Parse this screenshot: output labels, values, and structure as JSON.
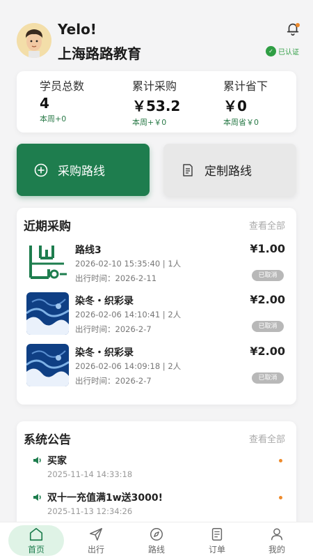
{
  "header": {
    "greeting": "Yelo!",
    "org_name": "上海路路教育",
    "verified_label": "已认证"
  },
  "stats": [
    {
      "label": "学员总数",
      "value": "4",
      "sub": "本周+0"
    },
    {
      "label": "累计采购",
      "value": "￥53.2",
      "sub": "本周+￥0"
    },
    {
      "label": "累计省下",
      "value": "￥0",
      "sub": "本周省￥0"
    }
  ],
  "actions": {
    "purchase_label": "采购路线",
    "custom_label": "定制路线"
  },
  "recent": {
    "title": "近期采购",
    "view_all": "查看全部",
    "items": [
      {
        "name": "路线3",
        "meta": "2026-02-10 15:35:40 | 1人",
        "date": "出行时间：2026-2-11",
        "price": "¥1.00",
        "status": "已取消",
        "thumb": "route-logo"
      },
      {
        "name": "染冬・织彩录",
        "meta": "2026-02-06 14:10:41 | 2人",
        "date": "出行时间：2026-2-7",
        "price": "¥2.00",
        "status": "已取消",
        "thumb": "blue-art"
      },
      {
        "name": "染冬・织彩录",
        "meta": "2026-02-06 14:09:18 | 2人",
        "date": "出行时间：2026-2-7",
        "price": "¥2.00",
        "status": "已取消",
        "thumb": "blue-art"
      }
    ]
  },
  "notices": {
    "title": "系统公告",
    "view_all": "查看全部",
    "items": [
      {
        "title": "买家",
        "time": "2025-11-14 14:33:18"
      },
      {
        "title": "双十一充值满1w送3000!",
        "time": "2025-11-13 12:34:26"
      }
    ]
  },
  "tabbar": {
    "items": [
      {
        "label": "首页",
        "icon": "home-icon",
        "active": true
      },
      {
        "label": "出行",
        "icon": "send-icon",
        "active": false
      },
      {
        "label": "路线",
        "icon": "compass-icon",
        "active": false
      },
      {
        "label": "订单",
        "icon": "list-icon",
        "active": false
      },
      {
        "label": "我的",
        "icon": "user-icon",
        "active": false
      }
    ]
  },
  "colors": {
    "brand": "#1e7d4e",
    "accent_orange": "#ee8a2b",
    "verified_green": "#2f9e44"
  }
}
